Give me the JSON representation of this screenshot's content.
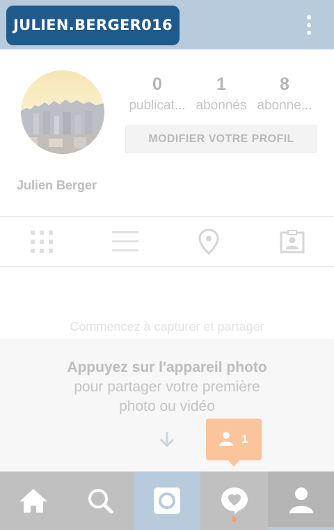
{
  "header": {
    "username": "JULIEN.BERGER016",
    "menu_icon": "overflow-menu-icon",
    "background_color": "#b8cbdc",
    "badge_color": "#1e5b8c"
  },
  "profile": {
    "avatar_icon": "city-skyline-avatar",
    "stats": [
      {
        "value": "0",
        "label": "publicat..."
      },
      {
        "value": "1",
        "label": "abonnés"
      },
      {
        "value": "8",
        "label": "abonne..."
      }
    ],
    "edit_button_label": "MODIFIER VOTRE PROFIL",
    "full_name": "Julien Berger"
  },
  "tabs": [
    {
      "icon": "grid-icon"
    },
    {
      "icon": "list-icon"
    },
    {
      "icon": "location-pin-icon"
    },
    {
      "icon": "tagged-photos-icon"
    }
  ],
  "empty_state": {
    "start_text": "Commencez à capturer et partager",
    "hint_title": "Appuyez sur l'appareil photo",
    "hint_line_1": "pour partager votre première",
    "hint_line_2": "photo ou vidéo",
    "arrow_icon": "arrow-down-icon"
  },
  "notification_tooltip": {
    "icon": "person-icon",
    "count": "1",
    "color": "#fcc49a"
  },
  "bottom_nav": [
    {
      "icon": "home-icon"
    },
    {
      "icon": "search-icon"
    },
    {
      "icon": "camera-icon"
    },
    {
      "icon": "activity-heart-icon"
    },
    {
      "icon": "profile-icon"
    }
  ]
}
